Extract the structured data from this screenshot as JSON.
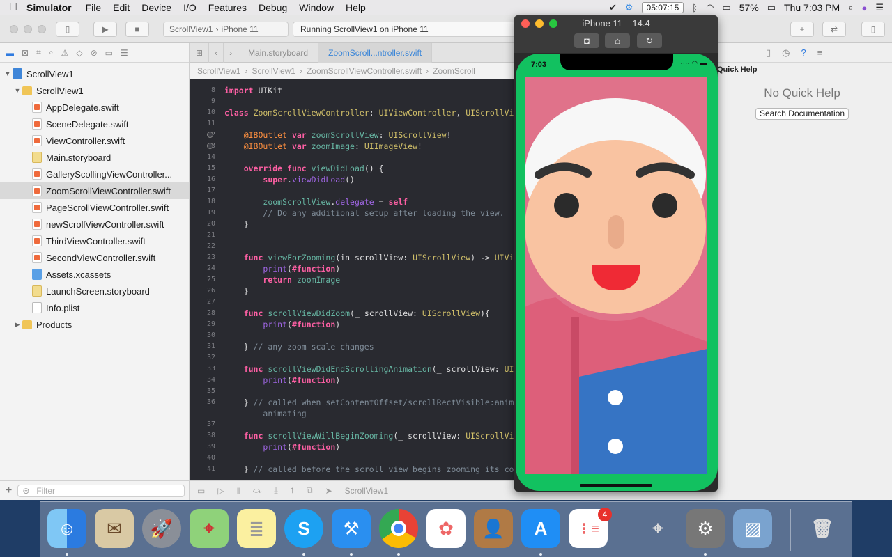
{
  "menubar": {
    "app_name": "Simulator",
    "items": [
      "File",
      "Edit",
      "Device",
      "I/O",
      "Features",
      "Debug",
      "Window",
      "Help"
    ],
    "clock_box": "05:07:15",
    "battery": "57%",
    "datetime": "Thu 7:03 PM"
  },
  "xcode": {
    "scheme_target": "ScrollView1",
    "scheme_device": "iPhone 11",
    "status": "Running ScrollView1 on iPhone 11",
    "navigator": {
      "items": [
        {
          "label": "ScrollView1",
          "kind": "proj",
          "indent": 0,
          "disclosure": "▼"
        },
        {
          "label": "ScrollView1",
          "kind": "folder",
          "indent": 1,
          "disclosure": "▼"
        },
        {
          "label": "AppDelegate.swift",
          "kind": "swift",
          "indent": 2,
          "disclosure": ""
        },
        {
          "label": "SceneDelegate.swift",
          "kind": "swift",
          "indent": 2,
          "disclosure": ""
        },
        {
          "label": "ViewController.swift",
          "kind": "swift",
          "indent": 2,
          "disclosure": ""
        },
        {
          "label": "Main.storyboard",
          "kind": "sb",
          "indent": 2,
          "disclosure": ""
        },
        {
          "label": "GallerySc­ollingViewController...",
          "kind": "swift",
          "indent": 2,
          "disclosure": ""
        },
        {
          "label": "ZoomScrollViewController.swift",
          "kind": "swift",
          "indent": 2,
          "disclosure": "",
          "selected": true
        },
        {
          "label": "PageScrollViewController.swift",
          "kind": "swift",
          "indent": 2,
          "disclosure": ""
        },
        {
          "label": "newScrollViewController.swift",
          "kind": "swift",
          "indent": 2,
          "disclosure": ""
        },
        {
          "label": "ThirdViewController.swift",
          "kind": "swift",
          "indent": 2,
          "disclosure": ""
        },
        {
          "label": "SecondViewController.swift",
          "kind": "swift",
          "indent": 2,
          "disclosure": ""
        },
        {
          "label": "Assets.xcassets",
          "kind": "assets",
          "indent": 2,
          "disclosure": ""
        },
        {
          "label": "LaunchScreen.storyboard",
          "kind": "sb",
          "indent": 2,
          "disclosure": ""
        },
        {
          "label": "Info.plist",
          "kind": "plist",
          "indent": 2,
          "disclosure": ""
        },
        {
          "label": "Products",
          "kind": "folder",
          "indent": 1,
          "disclosure": "▶"
        }
      ],
      "filter_placeholder": "Filter"
    },
    "editor_tabs": [
      "Main.storyboard",
      "ZoomScroll...ntroller.swift"
    ],
    "jumpbar": [
      "ScrollView1",
      "ScrollView1",
      "ZoomScrollViewController.swift",
      "ZoomScroll"
    ],
    "bottom_label": "ScrollView1",
    "inspector": {
      "title": "Quick Help",
      "empty": "No Quick Help",
      "button": "Search Documentation"
    }
  },
  "code_lines": [
    {
      "n": "8",
      "html": "<span class=\"kw\">import</span> UIKit"
    },
    {
      "n": "9",
      "html": ""
    },
    {
      "n": "10",
      "html": "<span class=\"kw\">class</span> <span class=\"ty\">ZoomScrollViewController</span>: <span class=\"ty\">UIViewController</span>, <span class=\"ty\">UIScrollView</span>"
    },
    {
      "n": "11",
      "html": ""
    },
    {
      "n": "12",
      "html": "    <span class=\"at\">@IBOutlet</span> <span class=\"kw\">var</span> <span class=\"fn\">zoomScrollView</span>: <span class=\"ty\">UIScrollView</span>!",
      "bp": true
    },
    {
      "n": "13",
      "html": "    <span class=\"at\">@IBOutlet</span> <span class=\"kw\">var</span> <span class=\"fn\">zoomImage</span>: <span class=\"ty\">UIImageView</span>!",
      "bp": true
    },
    {
      "n": "14",
      "html": ""
    },
    {
      "n": "15",
      "html": "    <span class=\"kw\">override</span> <span class=\"kw\">func</span> <span class=\"fn\">viewDidLoad</span>() {"
    },
    {
      "n": "16",
      "html": "        <span class=\"kw\">super</span>.<span class=\"pr\">viewDidLoad</span>()"
    },
    {
      "n": "17",
      "html": ""
    },
    {
      "n": "18",
      "html": "        <span class=\"fn\">zoomScrollView</span>.<span class=\"pr\">delegate</span> = <span class=\"kw\">self</span>"
    },
    {
      "n": "19",
      "html": "        <span class=\"cm\">// Do any additional setup after loading the view.</span>"
    },
    {
      "n": "20",
      "html": "    }"
    },
    {
      "n": "21",
      "html": ""
    },
    {
      "n": "22",
      "html": ""
    },
    {
      "n": "23",
      "html": "    <span class=\"kw\">func</span> <span class=\"fn\">viewForZooming</span>(in scrollView: <span class=\"ty\">UIScrollView</span>) -> <span class=\"ty\">UIVie</span>"
    },
    {
      "n": "24",
      "html": "        <span class=\"pr\">print</span>(<span class=\"kw\">#function</span>)"
    },
    {
      "n": "25",
      "html": "        <span class=\"kw\">return</span> <span class=\"fn\">zoomImage</span>"
    },
    {
      "n": "26",
      "html": "    }"
    },
    {
      "n": "27",
      "html": ""
    },
    {
      "n": "28",
      "html": "    <span class=\"kw\">func</span> <span class=\"fn\">scrollViewDidZoom</span>(_ scrollView: <span class=\"ty\">UIScrollView</span>){"
    },
    {
      "n": "29",
      "html": "        <span class=\"pr\">print</span>(<span class=\"kw\">#function</span>)"
    },
    {
      "n": "30",
      "html": ""
    },
    {
      "n": "31",
      "html": "    } <span class=\"cm\">// any zoom scale changes</span>"
    },
    {
      "n": "32",
      "html": ""
    },
    {
      "n": "33",
      "html": "    <span class=\"kw\">func</span> <span class=\"fn\">scrollViewDidEndScrollingAnimation</span>(_ scrollView: <span class=\"ty\">UIS</span>"
    },
    {
      "n": "34",
      "html": "        <span class=\"pr\">print</span>(<span class=\"kw\">#function</span>)"
    },
    {
      "n": "35",
      "html": ""
    },
    {
      "n": "36",
      "html": "    } <span class=\"cm\">// called when setContentOffset/scrollRectVisible:anima</span>"
    },
    {
      "n": "",
      "html": "        <span class=\"cm\">animating</span>"
    },
    {
      "n": "37",
      "html": ""
    },
    {
      "n": "38",
      "html": "    <span class=\"kw\">func</span> <span class=\"fn\">scrollViewWillBeginZooming</span>(_ scrollView: <span class=\"ty\">UIScrollView</span>"
    },
    {
      "n": "39",
      "html": "        <span class=\"pr\">print</span>(<span class=\"kw\">#function</span>)"
    },
    {
      "n": "40",
      "html": ""
    },
    {
      "n": "41",
      "html": "    } <span class=\"cm\">// called before the scroll view begins zooming its con</span>"
    }
  ],
  "simulator": {
    "window_title": "iPhone 11 – 14.4",
    "phone_time": "7:03"
  },
  "dock": {
    "reminders_badge": "4"
  }
}
